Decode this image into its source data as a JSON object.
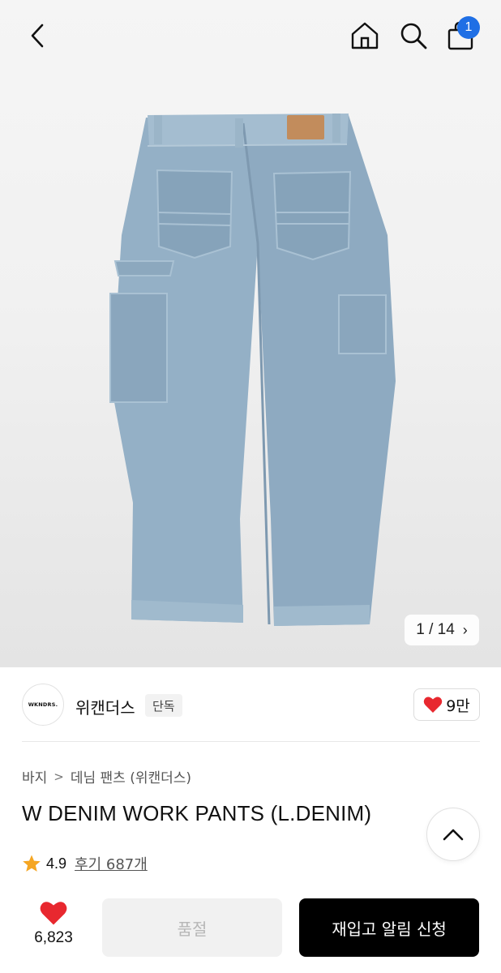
{
  "header": {
    "back_icon": "chevron-left-icon",
    "home_icon": "home-icon",
    "search_icon": "search-icon",
    "cart_icon": "shopping-bag-icon",
    "cart_count": "1",
    "badge_color": "#1f6fe5"
  },
  "gallery": {
    "counter": "1 / 14",
    "next_icon": "chevron-right-icon"
  },
  "brand": {
    "logo_text": "WKNDRS.",
    "name": "위캔더스",
    "tag": "단독",
    "like_label": "9만",
    "heart_color": "#e8282f"
  },
  "breadcrumb": {
    "items": [
      "바지",
      "데님 팬츠 (위캔더스)"
    ]
  },
  "product": {
    "title": "W DENIM WORK PANTS (L.DENIM)",
    "rating": "4.9",
    "reviews": "후기 687개"
  },
  "bottom": {
    "like_count": "6,823",
    "soldout_label": "품절",
    "restock_label": "재입고 알림 신청"
  }
}
